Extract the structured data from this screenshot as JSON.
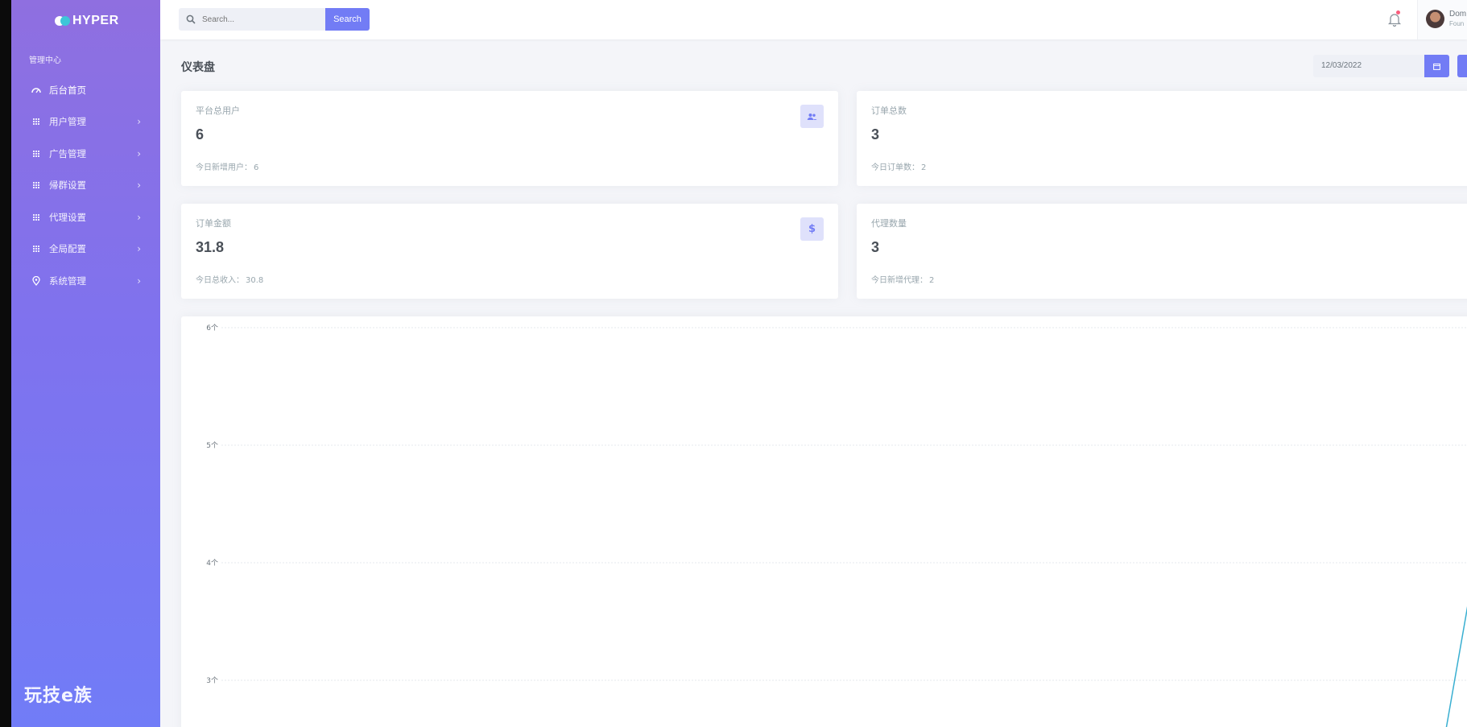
{
  "sidebar": {
    "logo_text": "HYPER",
    "nav_title": "管理中心",
    "items": [
      {
        "label": "后台首页",
        "icon": "dashboard-icon",
        "active": true,
        "has_chevron": false
      },
      {
        "label": "用户管理",
        "icon": "grid-icon",
        "has_chevron": true
      },
      {
        "label": "广告管理",
        "icon": "grid-icon",
        "has_chevron": true
      },
      {
        "label": "帰群设置",
        "icon": "grid-icon",
        "has_chevron": true
      },
      {
        "label": "代理设置",
        "icon": "grid-icon",
        "has_chevron": true
      },
      {
        "label": "全局配置",
        "icon": "grid-icon",
        "has_chevron": true
      },
      {
        "label": "系统管理",
        "icon": "location-pin-icon",
        "has_chevron": true
      }
    ],
    "chevron": "›",
    "bottom_brand": "玩技e族"
  },
  "topbar": {
    "search_placeholder": "Search...",
    "search_button": "Search",
    "user_name": "Dom",
    "user_role": "Foun"
  },
  "page": {
    "title": "仪表盘",
    "date_value": "12/03/2022"
  },
  "cards": {
    "users": {
      "label": "平台总用户",
      "value": "6",
      "sub_label": "今日新增用户：",
      "sub_value": "6",
      "icon": "users-icon"
    },
    "orders": {
      "label": "订单总数",
      "value": "3",
      "sub_label": "今日订单数：",
      "sub_value": "2"
    },
    "amount": {
      "label": "订单金额",
      "value": "31.8",
      "sub_label": "今日总收入：",
      "sub_value": "30.8",
      "icon": "dollar-icon",
      "icon_glyph": "$"
    },
    "agents": {
      "label": "代理数量",
      "value": "3",
      "sub_label": "今日新增代理：",
      "sub_value": "2"
    }
  },
  "colors": {
    "primary": "#727cf5",
    "sidebar_top": "#8f6fe0",
    "sidebar_bottom": "#717cf7",
    "chart_line": "#39afd1",
    "badge": "#fa5c7c"
  },
  "chart_data": {
    "type": "line",
    "y_ticks": [
      "6个",
      "5个",
      "4个",
      "3个"
    ],
    "ylim_visible": [
      2.6,
      6
    ],
    "grid": true,
    "series": [
      {
        "points_visible": [
          {
            "y": 2.6,
            "x_frac": 0.97
          },
          {
            "y": 4.5,
            "x_frac": 1.0
          }
        ]
      }
    ]
  }
}
